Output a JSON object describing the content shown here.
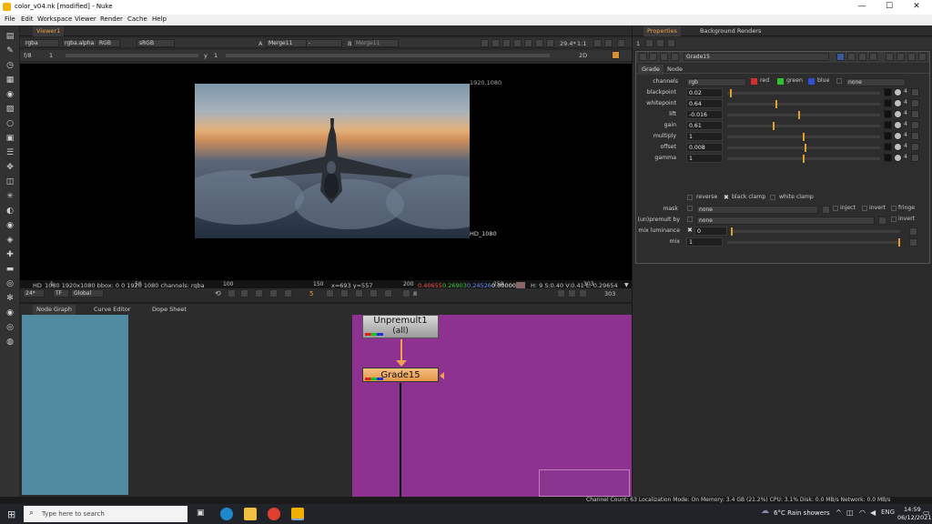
{
  "window": {
    "title": "color_v04.nk [modified] - Nuke",
    "minimize": "—",
    "maximize": "☐",
    "close": "✕"
  },
  "menu": [
    "File",
    "Edit",
    "Workspace",
    "Viewer",
    "Render",
    "Cache",
    "Help"
  ],
  "viewer": {
    "tab": "Viewer1",
    "controls": {
      "layer": "rgba",
      "channel": "rgba.alpha",
      "display": "RGB",
      "colorspace": "sRGB",
      "input_a_label": "A",
      "input_a": "Merge11",
      "wipe": "-",
      "input_b_label": "B",
      "input_b": "Merge11",
      "zoom": "29.4*",
      "ratio": "1:1",
      "fstop": "f/8",
      "frame": "1",
      "gamma_label": "y",
      "gamma": "1",
      "view": "2D"
    },
    "format_top": "1920,1080",
    "format_bottom": "HD_1080",
    "info": "HD_1080 1920x1080  bbox: 0 0 1920 1080 channels: rgba",
    "coords": "x=693 y=557",
    "pixel_r": "0.40655",
    "pixel_g": "0.26903",
    "pixel_b": "0.24526",
    "pixel_a": "0.00000",
    "hsv": "H:  9 S:0.40 V:0.41  L: 0.29654"
  },
  "timeline": {
    "ticks": [
      "1",
      "50",
      "100",
      "150",
      "200",
      "250",
      "303"
    ],
    "end_frame": "303",
    "fps": "24*",
    "tf": "TF",
    "range": "Global",
    "current_frame": "5",
    "increment": "8",
    "progress": 0.013
  },
  "nodegraph": {
    "tabs": [
      "Node Graph",
      "Curve Editor",
      "Dope Sheet"
    ],
    "nodes": [
      {
        "name": "Unpremult1",
        "sub": "(all)"
      },
      {
        "name": "Grade15"
      }
    ]
  },
  "properties": {
    "tabs": [
      "Properties",
      "Background Renders"
    ],
    "node_name": "Grade15",
    "subtabs": [
      "Grade",
      "Node"
    ],
    "channels_label": "channels",
    "channels": "rgb",
    "red": "red",
    "green": "green",
    "blue": "blue",
    "none": "none",
    "params": [
      {
        "label": "blackpoint",
        "value": "0.02",
        "pos": 0.02
      },
      {
        "label": "whitepoint",
        "value": "0.64",
        "pos": 0.32
      },
      {
        "label": "lift",
        "value": "-0.016",
        "pos": 0.47
      },
      {
        "label": "gain",
        "value": "0.61",
        "pos": 0.3
      },
      {
        "label": "multiply",
        "value": "1",
        "pos": 0.5
      },
      {
        "label": "offset",
        "value": "0.008",
        "pos": 0.51
      },
      {
        "label": "gamma",
        "value": "1",
        "pos": 0.5
      }
    ],
    "reverse": "reverse",
    "black_clamp": "black clamp",
    "white_clamp": "white clamp",
    "mask_label": "mask",
    "mask": "none",
    "inject": "inject",
    "invert": "invert",
    "fringe": "fringe",
    "unpremult_label": "(un)premult by",
    "unpremult": "none",
    "invert2": "invert",
    "mix_lum_label": "mix luminance",
    "mix_lum": "0",
    "mix_label": "mix",
    "mix": "1"
  },
  "status": "Channel Count: 63  Localization Mode: On  Memory: 3.4 GB (21.2%)  CPU: 3.1%  Disk: 0.0 MB/s  Network: 0.0 MB/s",
  "taskbar": {
    "search": "Type here to search",
    "weather": "6°C  Rain showers",
    "time": "14:59",
    "date": "06/12/2021"
  }
}
